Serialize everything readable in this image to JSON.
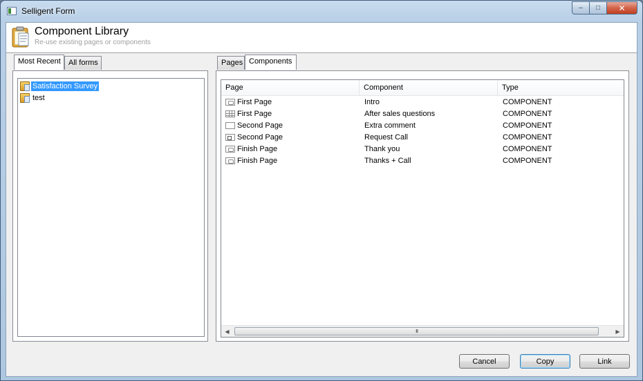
{
  "window": {
    "title": "Selligent Form"
  },
  "caption": {
    "minimize": "‒",
    "maximize": "□",
    "close": "✕"
  },
  "header": {
    "title": "Component Library",
    "subtitle": "Re-use existing pages or components"
  },
  "left_tabs": [
    {
      "label": "Most Recent",
      "active": true
    },
    {
      "label": "All forms",
      "active": false
    }
  ],
  "tree": {
    "items": [
      {
        "label": "Satisfaction Survey",
        "selected": true
      },
      {
        "label": "test",
        "selected": false
      }
    ]
  },
  "right_tabs": [
    {
      "label": "Pages",
      "active": false
    },
    {
      "label": "Components",
      "active": true
    }
  ],
  "grid": {
    "columns": [
      "Page",
      "Component",
      "Type"
    ],
    "rows": [
      {
        "page": "First Page",
        "component": "Intro",
        "type": "COMPONENT",
        "icon": "page-card-icon"
      },
      {
        "page": "First Page",
        "component": "After sales questions",
        "type": "COMPONENT",
        "icon": "table-grid-icon"
      },
      {
        "page": "Second Page",
        "component": "Extra comment",
        "type": "COMPONENT",
        "icon": "text-box-icon"
      },
      {
        "page": "Second Page",
        "component": "Request Call",
        "type": "COMPONENT",
        "icon": "checkbox-icon"
      },
      {
        "page": "Finish Page",
        "component": "Thank you",
        "type": "COMPONENT",
        "icon": "page-card-icon"
      },
      {
        "page": "Finish Page",
        "component": "Thanks + Call",
        "type": "COMPONENT",
        "icon": "page-card-icon"
      }
    ],
    "scroll_left": "◀",
    "scroll_right": "▶",
    "scroll_grip": "III"
  },
  "buttons": {
    "cancel": "Cancel",
    "copy": "Copy",
    "link": "Link"
  },
  "colors": {
    "selection": "#3399ff",
    "title_bar": "#b8cfe6"
  }
}
